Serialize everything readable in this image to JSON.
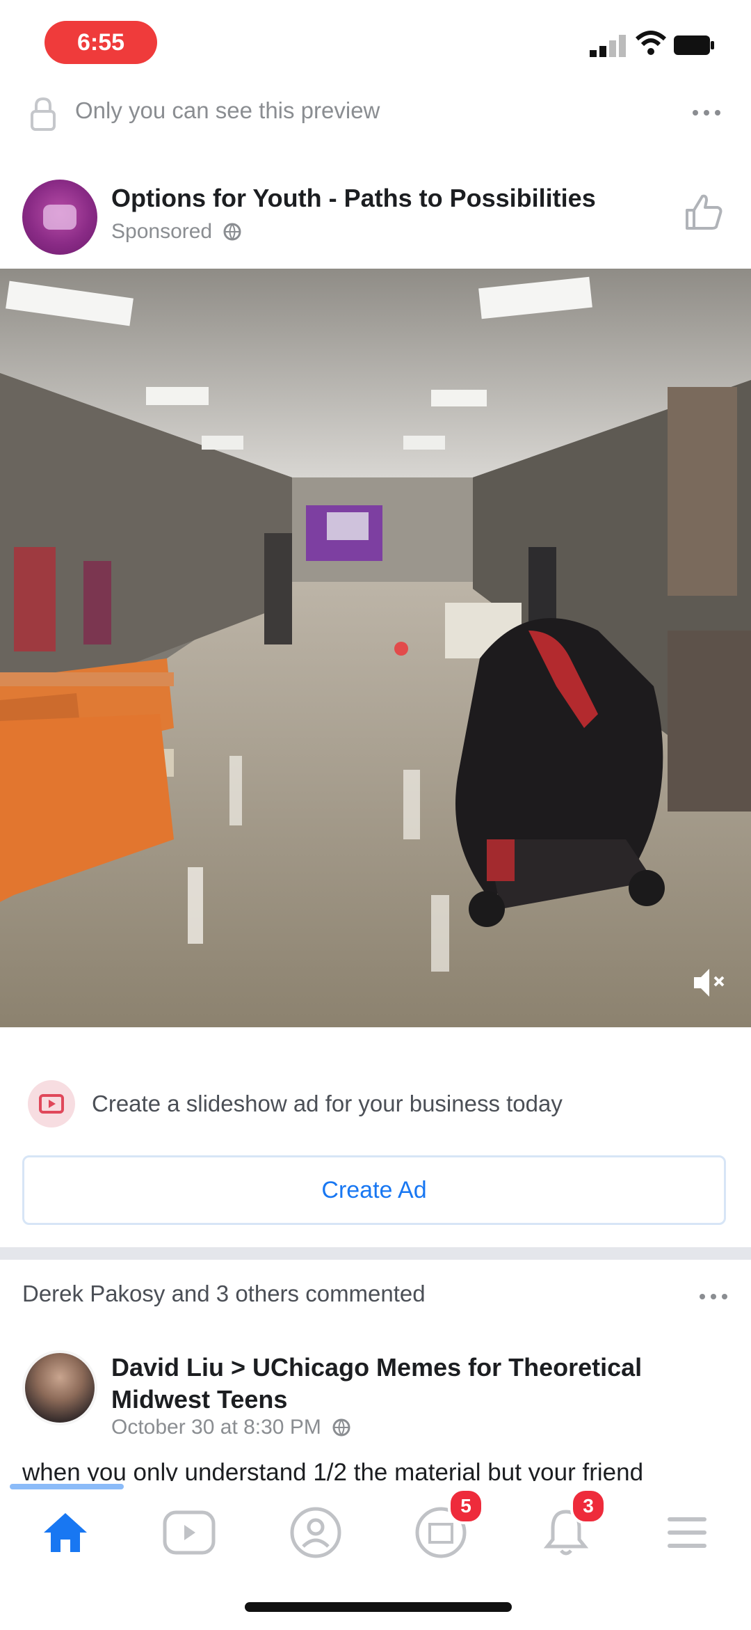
{
  "status_bar": {
    "time": "6:55"
  },
  "preview_banner": {
    "text": "Only you can see this preview"
  },
  "sponsored_post": {
    "author": "Options for Youth - Paths to Possibilities",
    "subtitle": "Sponsored"
  },
  "cta": {
    "text": "Create a slideshow ad for your business today",
    "button_label": "Create Ad"
  },
  "feed_post": {
    "activity": "Derek Pakosy and 3 others commented",
    "title": "David Liu > UChicago Memes for Theoretical Midwest Teens",
    "meta": "October 30 at 8:30 PM",
    "text": "when you only understand 1/2 the material but your friend"
  },
  "bottom_nav": {
    "items": [
      {
        "name": "home",
        "icon": "home-icon",
        "active": true
      },
      {
        "name": "watch",
        "icon": "watch-icon"
      },
      {
        "name": "profile",
        "icon": "profile-icon"
      },
      {
        "name": "marketplace",
        "icon": "marketplace-icon",
        "badge": "5"
      },
      {
        "name": "notifications",
        "icon": "bell-icon",
        "badge": "3"
      },
      {
        "name": "menu",
        "icon": "menu-icon"
      }
    ]
  },
  "colors": {
    "accent": "#1877f2",
    "badge": "#ee2b3b",
    "status_pill": "#ef3b3b"
  }
}
